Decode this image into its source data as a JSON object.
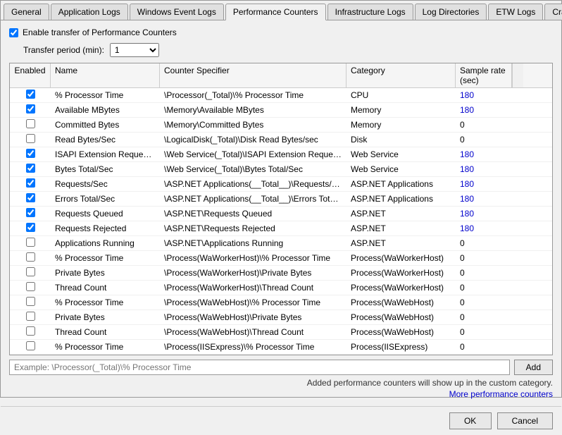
{
  "tabs": [
    {
      "label": "General",
      "active": false
    },
    {
      "label": "Application Logs",
      "active": false
    },
    {
      "label": "Windows Event Logs",
      "active": false
    },
    {
      "label": "Performance Counters",
      "active": true
    },
    {
      "label": "Infrastructure Logs",
      "active": false
    },
    {
      "label": "Log Directories",
      "active": false
    },
    {
      "label": "ETW Logs",
      "active": false
    },
    {
      "label": "Crash Dumps",
      "active": false
    }
  ],
  "enable_checkbox_label": "Enable transfer of Performance Counters",
  "enable_checked": true,
  "transfer_period_label": "Transfer period (min):",
  "transfer_period_value": "1",
  "columns": [
    "Enabled",
    "Name",
    "Counter Specifier",
    "Category",
    "Sample rate (sec)"
  ],
  "rows": [
    {
      "checked": true,
      "name": "% Processor Time",
      "specifier": "\\Processor(_Total)\\% Processor Time",
      "category": "CPU",
      "rate": "180",
      "rate_blue": true
    },
    {
      "checked": true,
      "name": "Available MBytes",
      "specifier": "\\Memory\\Available MBytes",
      "category": "Memory",
      "rate": "180",
      "rate_blue": true
    },
    {
      "checked": false,
      "name": "Committed Bytes",
      "specifier": "\\Memory\\Committed Bytes",
      "category": "Memory",
      "rate": "0",
      "rate_blue": false
    },
    {
      "checked": false,
      "name": "Read Bytes/Sec",
      "specifier": "\\LogicalDisk(_Total)\\Disk Read Bytes/sec",
      "category": "Disk",
      "rate": "0",
      "rate_blue": false
    },
    {
      "checked": true,
      "name": "ISAPI Extension Requests/...",
      "specifier": "\\Web Service(_Total)\\ISAPI Extension Requests/sec",
      "category": "Web Service",
      "rate": "180",
      "rate_blue": true
    },
    {
      "checked": true,
      "name": "Bytes Total/Sec",
      "specifier": "\\Web Service(_Total)\\Bytes Total/Sec",
      "category": "Web Service",
      "rate": "180",
      "rate_blue": true
    },
    {
      "checked": true,
      "name": "Requests/Sec",
      "specifier": "\\ASP.NET Applications(__Total__)\\Requests/Sec",
      "category": "ASP.NET Applications",
      "rate": "180",
      "rate_blue": true
    },
    {
      "checked": true,
      "name": "Errors Total/Sec",
      "specifier": "\\ASP.NET Applications(__Total__)\\Errors Total/Sec",
      "category": "ASP.NET Applications",
      "rate": "180",
      "rate_blue": true
    },
    {
      "checked": true,
      "name": "Requests Queued",
      "specifier": "\\ASP.NET\\Requests Queued",
      "category": "ASP.NET",
      "rate": "180",
      "rate_blue": true
    },
    {
      "checked": true,
      "name": "Requests Rejected",
      "specifier": "\\ASP.NET\\Requests Rejected",
      "category": "ASP.NET",
      "rate": "180",
      "rate_blue": true
    },
    {
      "checked": false,
      "name": "Applications Running",
      "specifier": "\\ASP.NET\\Applications Running",
      "category": "ASP.NET",
      "rate": "0",
      "rate_blue": false
    },
    {
      "checked": false,
      "name": "% Processor Time",
      "specifier": "\\Process(WaWorkerHost)\\% Processor Time",
      "category": "Process(WaWorkerHost)",
      "rate": "0",
      "rate_blue": false
    },
    {
      "checked": false,
      "name": "Private Bytes",
      "specifier": "\\Process(WaWorkerHost)\\Private Bytes",
      "category": "Process(WaWorkerHost)",
      "rate": "0",
      "rate_blue": false
    },
    {
      "checked": false,
      "name": "Thread Count",
      "specifier": "\\Process(WaWorkerHost)\\Thread Count",
      "category": "Process(WaWorkerHost)",
      "rate": "0",
      "rate_blue": false
    },
    {
      "checked": false,
      "name": "% Processor Time",
      "specifier": "\\Process(WaWebHost)\\% Processor Time",
      "category": "Process(WaWebHost)",
      "rate": "0",
      "rate_blue": false
    },
    {
      "checked": false,
      "name": "Private Bytes",
      "specifier": "\\Process(WaWebHost)\\Private Bytes",
      "category": "Process(WaWebHost)",
      "rate": "0",
      "rate_blue": false
    },
    {
      "checked": false,
      "name": "Thread Count",
      "specifier": "\\Process(WaWebHost)\\Thread Count",
      "category": "Process(WaWebHost)",
      "rate": "0",
      "rate_blue": false
    },
    {
      "checked": false,
      "name": "% Processor Time",
      "specifier": "\\Process(IISExpress)\\% Processor Time",
      "category": "Process(IISExpress)",
      "rate": "0",
      "rate_blue": false
    }
  ],
  "add_placeholder": "Example: \\Processor(_Total)\\% Processor Time",
  "add_button_label": "Add",
  "note_text": "Added performance counters will show up in the custom category.",
  "more_link_text": "More performance counters",
  "ok_label": "OK",
  "cancel_label": "Cancel"
}
